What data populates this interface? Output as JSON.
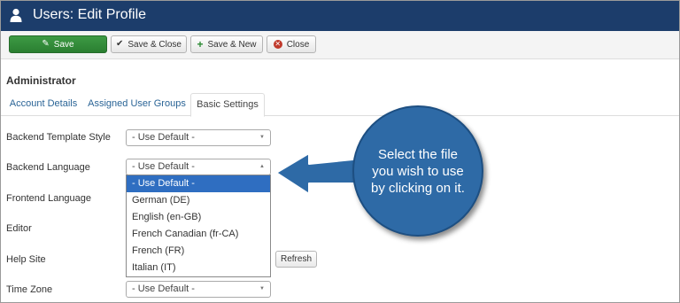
{
  "header": {
    "title": "Users: Edit Profile",
    "icon": "user-icon"
  },
  "toolbar": {
    "save_label": "Save",
    "save_close_label": "Save & Close",
    "save_new_label": "Save & New",
    "close_label": "Close"
  },
  "section": {
    "title": "Administrator"
  },
  "tabs": [
    {
      "label": "Account Details"
    },
    {
      "label": "Assigned User Groups"
    },
    {
      "label": "Basic Settings",
      "active": true
    }
  ],
  "form": {
    "backend_template_style": {
      "label": "Backend Template Style",
      "value": "- Use Default -"
    },
    "backend_language": {
      "label": "Backend Language",
      "value": "- Use Default -",
      "options": [
        "- Use Default -",
        "German (DE)",
        "English (en-GB)",
        "French Canadian (fr-CA)",
        "French (FR)",
        "Italian (IT)"
      ],
      "highlighted_option": "- Use Default -"
    },
    "frontend_language": {
      "label": "Frontend Language"
    },
    "editor": {
      "label": "Editor"
    },
    "help_site": {
      "label": "Help Site",
      "refresh_label": "Refresh"
    },
    "time_zone": {
      "label": "Time Zone",
      "value": "- Use Default -"
    }
  },
  "callout": {
    "text": "Select the file you wish to use by clicking on it."
  },
  "colors": {
    "header_bg": "#1c3d6b",
    "save_green": "#2b7f31",
    "link_blue": "#2a6496",
    "selected_blue": "#2f6ec1",
    "callout_blue": "#2e6aa6"
  }
}
